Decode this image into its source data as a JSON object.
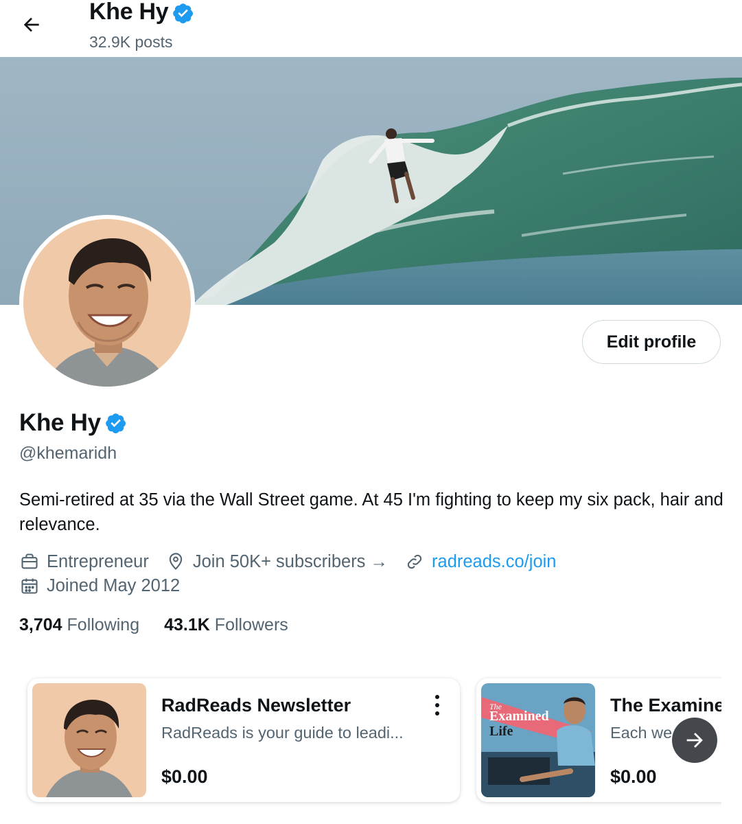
{
  "header": {
    "title": "Khe Hy",
    "posts": "32.9K posts"
  },
  "profile": {
    "name": "Khe Hy",
    "handle": "@khemaridh",
    "bio": "Semi-retired at 35 via the Wall Street game. At 45 I'm fighting to keep my six pack, hair and relevance.",
    "profession": "Entrepreneur",
    "location": "Join 50K+ subscribers →",
    "website": "radreads.co/join",
    "joined": "Joined May 2012",
    "edit_label": "Edit profile"
  },
  "stats": {
    "following_count": "3,704",
    "following_label": "Following",
    "followers_count": "43.1K",
    "followers_label": "Followers"
  },
  "products": [
    {
      "title": "RadReads Newsletter",
      "description": "RadReads is your guide to leadi...",
      "price": "$0.00"
    },
    {
      "title": "The Examine",
      "description": "Each we",
      "price": "$0.00",
      "thumb_text_1": "The",
      "thumb_text_2": "Examined",
      "thumb_text_3": "Life"
    }
  ],
  "colors": {
    "accent": "#1d9bf0",
    "secondary_text": "#536471",
    "primary_text": "#0f1419"
  },
  "icons": {
    "back": "arrow-left-icon",
    "verified": "verified-badge-icon",
    "profession": "briefcase-icon",
    "location": "location-pin-icon",
    "website": "link-icon",
    "joined": "calendar-icon",
    "more": "more-vertical-icon",
    "next": "arrow-right-icon"
  }
}
